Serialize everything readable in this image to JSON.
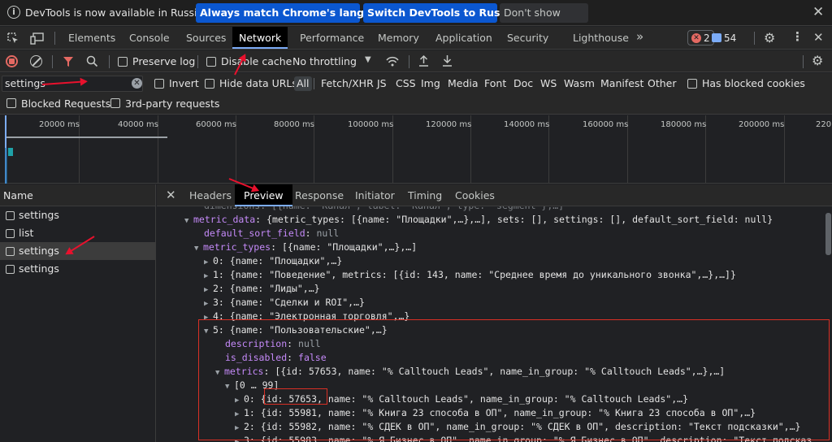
{
  "infobar": {
    "message": "DevTools is now available in Russian!",
    "match_button": "Always match Chrome's language",
    "switch_button": "Switch DevTools to Russian",
    "dismiss_button": "Don't show again"
  },
  "tabs": [
    "Elements",
    "Console",
    "Sources",
    "Network",
    "Performance",
    "Memory",
    "Application",
    "Security",
    "Lighthouse"
  ],
  "active_tab": "Network",
  "badges": {
    "errors": "2",
    "messages": "54"
  },
  "toolbar": {
    "preserve_log": "Preserve log",
    "disable_cache": "Disable cache",
    "throttling": "No throttling"
  },
  "filter": {
    "value": "settings",
    "invert": "Invert",
    "hide_data_urls": "Hide data URLs",
    "types": [
      "All",
      "Fetch/XHR",
      "JS",
      "CSS",
      "Img",
      "Media",
      "Font",
      "Doc",
      "WS",
      "Wasm",
      "Manifest",
      "Other"
    ],
    "has_blocked_cookies": "Has blocked cookies",
    "blocked_requests": "Blocked Requests",
    "third_party": "3rd-party requests"
  },
  "timeline_ticks": [
    "20000 ms",
    "40000 ms",
    "60000 ms",
    "80000 ms",
    "100000 ms",
    "120000 ms",
    "140000 ms",
    "160000 ms",
    "180000 ms",
    "200000 ms",
    "220"
  ],
  "name_panel": {
    "header": "Name",
    "rows": [
      "settings",
      "list",
      "settings",
      "settings"
    ]
  },
  "detail_tabs": [
    "Headers",
    "Preview",
    "Response",
    "Initiator",
    "Timing",
    "Cookies"
  ],
  "active_detail_tab": "Preview",
  "tree": {
    "l0_cut": "dimensions: [{name: \"Канал\", label: \"Канал\", type: \"segment\"},…]",
    "l1_key": "metric_data",
    "l1_val": "{metric_types: [{name: \"Площадки\",…},…], sets: [], settings: [], default_sort_field: null}",
    "l2_key": "default_sort_field",
    "l2_val": "null",
    "l3_key": "metric_types",
    "l3_val": "[{name: \"Площадки\",…},…]",
    "items": [
      "0: {name: \"Площадки\",…}",
      "1: {name: \"Поведение\", metrics: [{id: 143, name: \"Среднее время до уникального звонка\",…},…]}",
      "2: {name: \"Лиды\",…}",
      "3: {name: \"Сделки и ROI\",…}",
      "4: {name: \"Электронная торговля\",…}"
    ],
    "item5": "5: {name: \"Пользовательские\",…}",
    "desc_key": "description",
    "desc_val": "null",
    "dis_key": "is_disabled",
    "dis_val": "false",
    "metrics_key": "metrics",
    "metrics_val": "[{id: 57653, name: \"% Calltouch Leads\", name_in_group: \"% Calltouch Leads\",…},…]",
    "range": "[0 … 99]",
    "m0_pre": "0: {",
    "m0_id": "id: 57653,",
    "m0_post": " name: \"% Calltouch Leads\", name_in_group: \"% Calltouch Leads\",…}",
    "m1": "1: {id: 55981, name: \"% Книга 23 способа в ОП\", name_in_group: \"% Книга 23 способа в ОП\",…}",
    "m2": "2: {id: 55982, name: \"% СДЕК в ОП\", name_in_group: \"% СДЕК в ОП\", description: \"Текст подсказки\",…}",
    "m3": "3: {id: 55983, name: \"% Я.Бизнес в ОП\", name_in_group: \"% Я.Бизнес в ОП\", description: \"Текст подсказ"
  },
  "colors": {
    "accent": "#7cacf8",
    "annotation": "#e8112d",
    "highlight_box": "#d93025"
  }
}
